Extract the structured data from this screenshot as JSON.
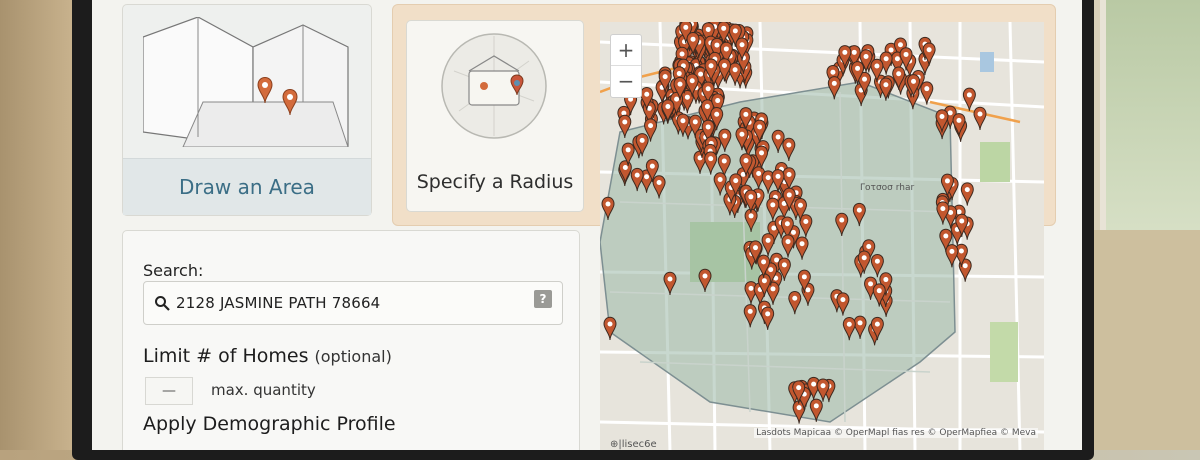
{
  "area_card": {
    "label": "Draw an Area"
  },
  "radius_card": {
    "label": "Specify a Radius"
  },
  "search": {
    "label": "Search:",
    "value": "2128 JASMINE PATH 78664",
    "help_label": "?"
  },
  "limit": {
    "title": "Limit # of Homes",
    "optional": "(optional)",
    "input_value": "—",
    "input_label": "max. quantity"
  },
  "demographic": {
    "title": "Apply Demographic Profile"
  },
  "map": {
    "zoom_in": "+",
    "zoom_out": "−",
    "attribution": "Lasdots Mapicaa © OperMapl fias res © OperMapfiea © Meva",
    "scale_text": "⊕|lisec6e",
    "street_labels": [
      "Γοτσοσ rhar"
    ]
  },
  "colors": {
    "accent_blue": "#3b6e86",
    "pin_fill": "#c2572f",
    "polygon_fill": "#9ab8a8"
  }
}
